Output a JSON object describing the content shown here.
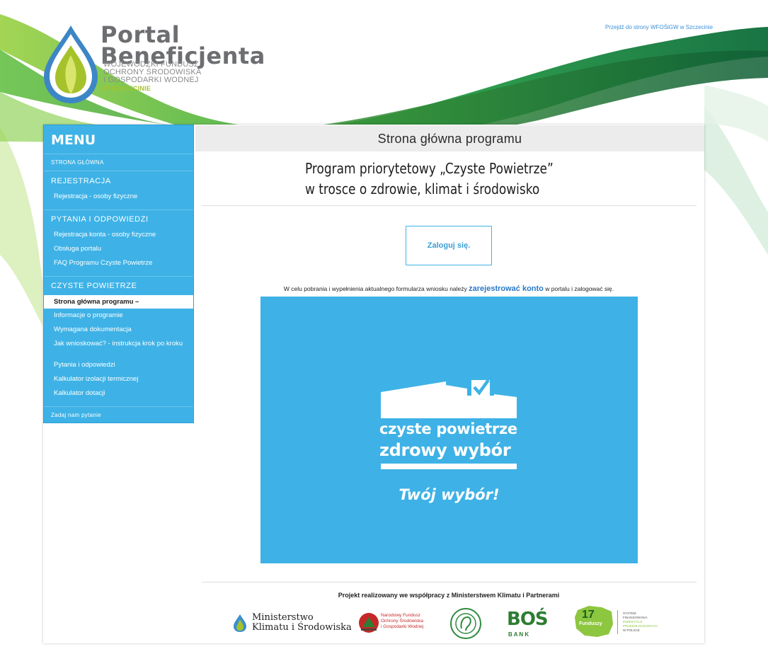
{
  "header": {
    "logo_line1": "Portal",
    "logo_line2": "Beneficjenta",
    "logo_sub1": "WOJEWÓDZKI FUNDUSZ",
    "logo_sub2": "OCHRONY ŚRODOWISKA",
    "logo_sub3": "I GOSPODARKI WODNEJ",
    "logo_sub4": "W SZCZECINIE",
    "top_link": "Przejdź do strony WFOŚiGW w Szczecinie"
  },
  "sidebar": {
    "title": "MENU",
    "home": "STRONA GŁÓWNA",
    "sections": [
      {
        "title": "REJESTRACJA",
        "items": [
          "Rejestracja - osoby fizyczne"
        ]
      },
      {
        "title": "PYTANIA I ODPOWIEDZI",
        "items": [
          "Rejestracja konta - osoby fizyczne",
          "Obsługa portalu",
          "FAQ Programu Czyste Powietrze"
        ]
      },
      {
        "title": "CZYSTE POWIETRZE",
        "items": [
          "Strona główna programu –",
          "Informacje o programie",
          "Wymagana dokumentacja",
          "Jak wnioskować? - instrukcja krok po kroku",
          "Pytania i odpowiedzi",
          "Kalkulator izolacji termicznej",
          "Kalkulator dotacji"
        ]
      }
    ],
    "active_item": "Strona główna programu –",
    "footer": "Zadaj nam pytanie"
  },
  "main": {
    "page_title": "Strona główna programu",
    "headline_line1": "Program priorytetowy „Czyste Powietrze”",
    "headline_line2": "w trosce o zdrowie, klimat i środowisko",
    "login_button": "Zaloguj się.",
    "info_prefix": "W celu pobrania i wypełnienia aktualnego formularza wniosku należy ",
    "info_link": "zarejestrować konto",
    "info_suffix": " w portalu i zalogować się.",
    "banner": {
      "line1": "czyste powietrze",
      "line2": "zdrowy wybór",
      "line3": "Twój wybór!"
    },
    "partners_title": "Projekt realizowany we współpracy z Ministerstwem Klimatu i Partnerami",
    "partners": {
      "ministry_line1": "Ministerstwo",
      "ministry_line2": "Klimatu i Środowiska",
      "nfos_line1": "Narodowy Fundusz",
      "nfos_line2": "Ochrony Środowiska",
      "nfos_line3": "i Gospodarki Wodnej",
      "bos_name": "BOŚ",
      "bos_sub": "B A N K",
      "fundusz_number": "17",
      "fundusz_word": "Funduszy",
      "sfipp_line1": "SYSTEM",
      "sfipp_line2": "FINANSOWANIA",
      "sfipp_line3": "INWESTYCJI",
      "sfipp_line4": "PROEKOLOGICZNYCH",
      "sfipp_line5": "W POLSCE"
    }
  },
  "colors": {
    "sidebar_blue": "#3eb2e6",
    "link_blue": "#2a78c8",
    "logo_green": "#a6c22b"
  }
}
